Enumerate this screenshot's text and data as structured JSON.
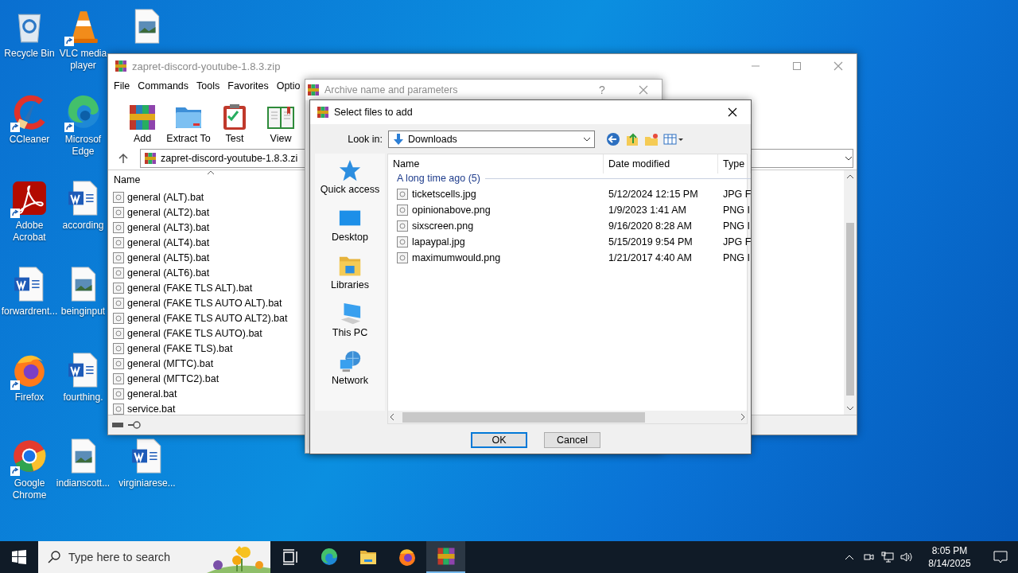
{
  "desktop": {
    "columns": [
      {
        "icons": [
          {
            "label": "Recycle Bin",
            "kind": "recycle",
            "shortcut": false
          },
          {
            "label": "CCleaner",
            "kind": "ccleaner",
            "shortcut": true
          },
          {
            "label": "Adobe Acrobat",
            "kind": "acrobat",
            "shortcut": true
          },
          {
            "label": "forwardrent...",
            "kind": "word",
            "shortcut": false
          },
          {
            "label": "Firefox",
            "kind": "firefox",
            "shortcut": true
          },
          {
            "label": "Google Chrome",
            "kind": "chrome",
            "shortcut": true
          }
        ]
      },
      {
        "icons": [
          {
            "label": "VLC media player",
            "kind": "vlc",
            "shortcut": true
          },
          {
            "label": "Microsof Edge",
            "kind": "edge",
            "shortcut": true
          },
          {
            "label": "according",
            "kind": "word",
            "shortcut": false
          },
          {
            "label": "beinginput",
            "kind": "image",
            "shortcut": false
          },
          {
            "label": "fourthing.",
            "kind": "word",
            "shortcut": false
          },
          {
            "label": "indianscott...",
            "kind": "image",
            "shortcut": false
          }
        ]
      },
      {
        "icons": [
          {
            "kind": "image",
            "shortcut": false
          },
          {
            "label": "virginiarese...",
            "kind": "word",
            "shortcut": false
          }
        ]
      }
    ]
  },
  "archive_window": {
    "title": "zapret-discord-youtube-1.8.3.zip",
    "menu": [
      "File",
      "Commands",
      "Tools",
      "Favorites",
      "Optio"
    ],
    "toolbar": [
      {
        "label": "Add",
        "kind": "add"
      },
      {
        "label": "Extract To",
        "kind": "extract"
      },
      {
        "label": "Test",
        "kind": "test"
      },
      {
        "label": "View",
        "kind": "view"
      }
    ],
    "path": "zapret-discord-youtube-1.8.3.zi",
    "column": "Name",
    "files": [
      "general (ALT).bat",
      "general (ALT2).bat",
      "general (ALT3).bat",
      "general (ALT4).bat",
      "general (ALT5).bat",
      "general (ALT6).bat",
      "general (FAKE TLS ALT).bat",
      "general (FAKE TLS AUTO ALT).bat",
      "general (FAKE TLS AUTO ALT2).bat",
      "general (FAKE TLS AUTO).bat",
      "general (FAKE TLS).bat",
      "general (МГТС).bat",
      "general (МГТС2).bat",
      "general.bat",
      "service.bat"
    ]
  },
  "parameters_dialog": {
    "title": "Archive name and parameters",
    "help": "?"
  },
  "select_dialog": {
    "title": "Select files to add",
    "look_in_label": "Look in:",
    "look_in": "Downloads",
    "places": [
      {
        "label": "Quick access",
        "kind": "quick"
      },
      {
        "label": "Desktop",
        "kind": "desktop"
      },
      {
        "label": "Libraries",
        "kind": "libraries"
      },
      {
        "label": "This PC",
        "kind": "pc"
      },
      {
        "label": "Network",
        "kind": "network"
      }
    ],
    "columns": [
      "Name",
      "Date modified",
      "Type"
    ],
    "group": "A long time ago (5)",
    "files": [
      {
        "name": "ticketscells.jpg",
        "date": "5/12/2024 12:15 PM",
        "type": "JPG F"
      },
      {
        "name": "opinionabove.png",
        "date": "1/9/2023 1:41 AM",
        "type": "PNG I"
      },
      {
        "name": "sixscreen.png",
        "date": "9/16/2020 8:28 AM",
        "type": "PNG I"
      },
      {
        "name": "lapaypal.jpg",
        "date": "5/15/2019 9:54 PM",
        "type": "JPG F"
      },
      {
        "name": "maximumwould.png",
        "date": "1/21/2017 4:40 AM",
        "type": "PNG I"
      }
    ],
    "buttons": [
      {
        "label": "OK",
        "default": true
      },
      {
        "label": "Cancel",
        "default": false
      }
    ]
  },
  "taskbar": {
    "search_placeholder": "Type here to search",
    "apps": [
      {
        "kind": "taskview",
        "selected": false
      },
      {
        "kind": "edge",
        "selected": false
      },
      {
        "kind": "explorer",
        "selected": false
      },
      {
        "kind": "firefox",
        "selected": false
      },
      {
        "kind": "winrar",
        "selected": true
      }
    ],
    "time": "8:05 PM",
    "date": "8/14/2025"
  }
}
